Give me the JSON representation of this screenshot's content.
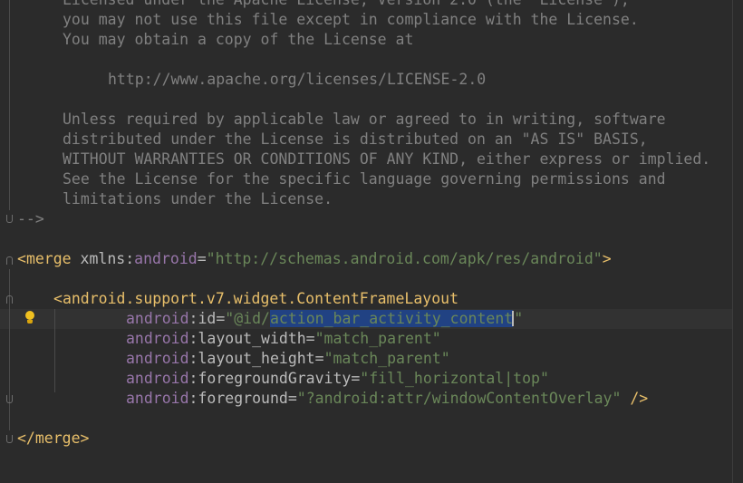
{
  "editor": {
    "language": "xml",
    "lines": {
      "l1": "Licensed under the Apache License, Version 2.0 (the \"License\");",
      "l2": "you may not use this file except in compliance with the License.",
      "l3": "You may obtain a copy of the License at",
      "l4": "http://www.apache.org/licenses/LICENSE-2.0",
      "l5": "Unless required by applicable law or agreed to in writing, software",
      "l6": "distributed under the License is distributed on an \"AS IS\" BASIS,",
      "l7": "WITHOUT WARRANTIES OR CONDITIONS OF ANY KIND, either express or implied.",
      "l8": "See the License for the specific language governing permissions and",
      "l9": "limitations under the License.",
      "comment_end": "-->",
      "merge_open_lt": "<",
      "merge_tag": "merge",
      "merge_xmlns_prefix": "xmlns:",
      "merge_android_ns": "android",
      "merge_eq": "=",
      "merge_value": "\"http://schemas.android.com/apk/res/android\"",
      "merge_gt": ">",
      "view_lt": "<",
      "view_tag": "android.support.v7.widget.ContentFrameLayout",
      "id_ns": "android",
      "id_attr": ":id=",
      "id_value_pre": "\"@id/",
      "id_value_selected": "action_bar_activity_content",
      "id_value_post": "\"",
      "lw_ns": "android",
      "lw_attr": ":layout_width=",
      "lw_value": "\"match_parent\"",
      "lh_ns": "android",
      "lh_attr": ":layout_height=",
      "lh_value": "\"match_parent\"",
      "fg_ns": "android",
      "fg_attr": ":foregroundGravity=",
      "fg_value": "\"fill_horizontal|top\"",
      "f_ns": "android",
      "f_attr": ":foreground=",
      "f_value": "\"?android:attr/windowContentOverlay\"",
      "f_close": " />",
      "merge_close": "</merge>"
    }
  },
  "colors": {
    "background": "#2b2b2b",
    "comment": "#808080",
    "tag": "#e8bf6a",
    "namespace": "#9876aa",
    "string": "#6a8759",
    "selection": "#214283"
  },
  "icons": {
    "gutter_hint": "lightbulb-icon",
    "fold_markers": "fold-marker-icon"
  }
}
